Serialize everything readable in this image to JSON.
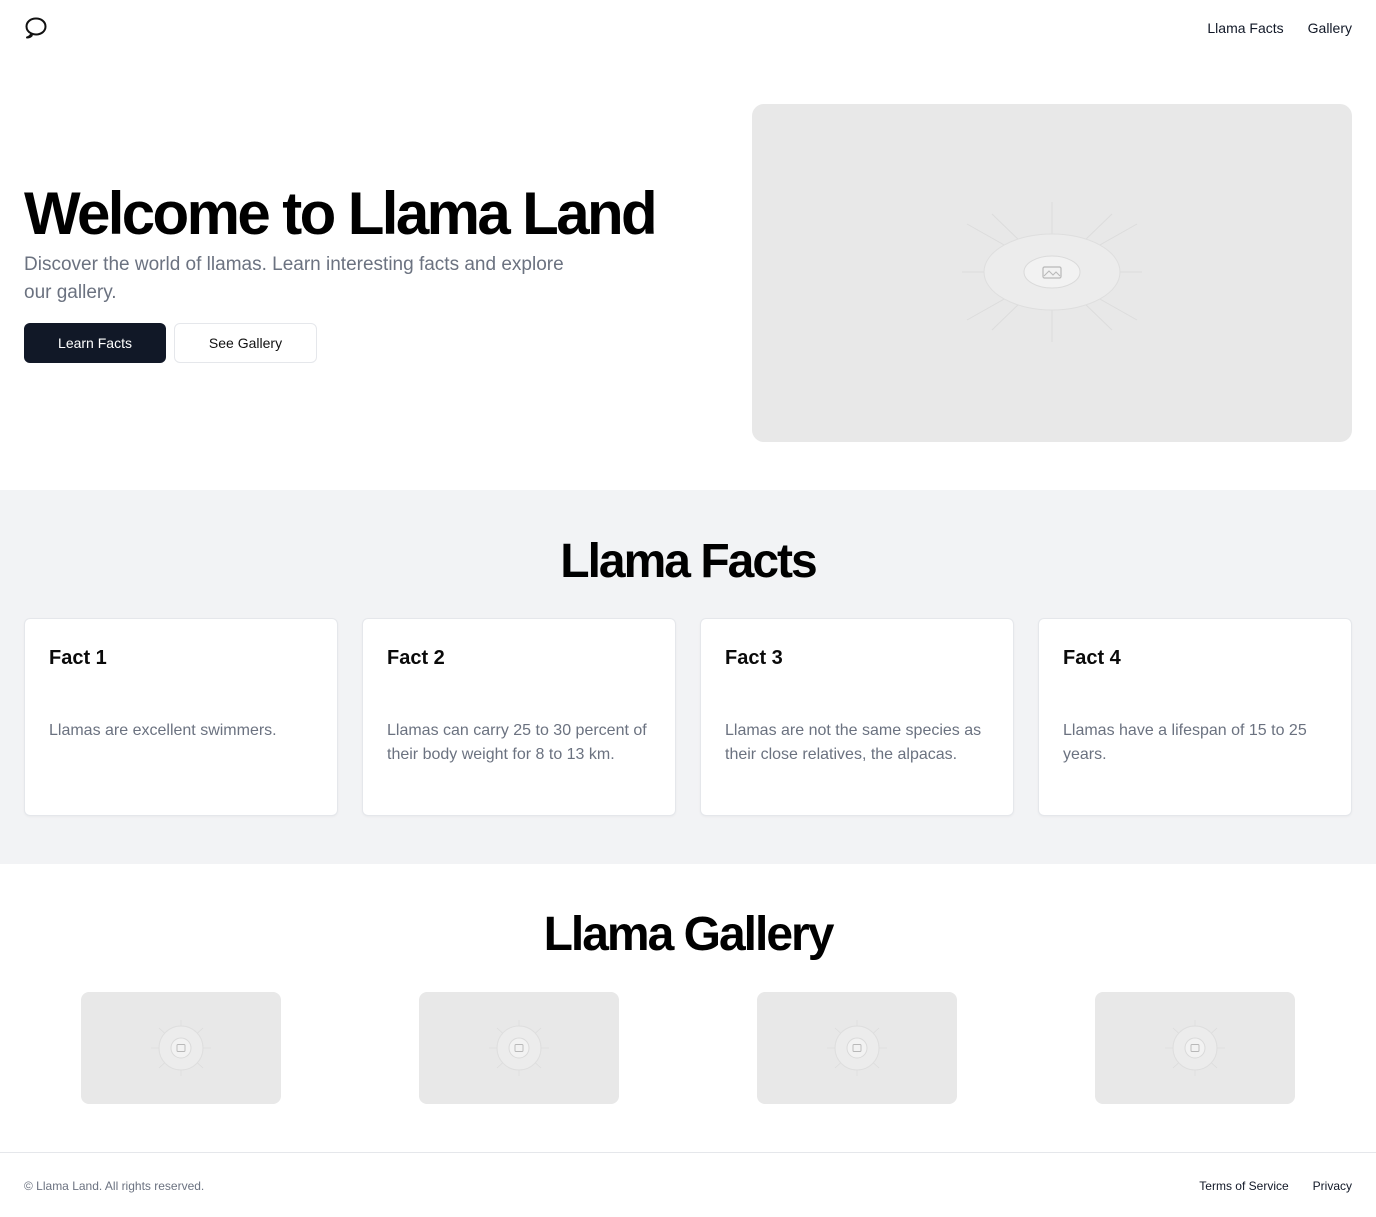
{
  "header": {
    "logo_icon": "speech-bubble-logo-icon",
    "nav": [
      "Llama Facts",
      "Gallery"
    ]
  },
  "hero": {
    "title": "Welcome to Llama Land",
    "subtitle": "Discover the world of llamas. Learn interesting facts and explore our gallery.",
    "primary_button": "Learn Facts",
    "secondary_button": "See Gallery",
    "image_icon": "image-placeholder-icon"
  },
  "facts": {
    "title": "Llama Facts",
    "items": [
      {
        "title": "Fact 1",
        "text": "Llamas are excellent swimmers."
      },
      {
        "title": "Fact 2",
        "text": "Llamas can carry 25 to 30 percent of their body weight for 8 to 13 km."
      },
      {
        "title": "Fact 3",
        "text": "Llamas are not the same species as their close relatives, the alpacas."
      },
      {
        "title": "Fact 4",
        "text": "Llamas have a lifespan of 15 to 25 years."
      }
    ]
  },
  "gallery": {
    "title": "Llama Gallery",
    "thumbnail_icon": "image-placeholder-icon",
    "thumbnail_count": 4
  },
  "footer": {
    "copyright": "© Llama Land. All rights reserved.",
    "links": [
      "Terms of Service",
      "Privacy"
    ]
  },
  "colors": {
    "primary_button_bg": "#111827",
    "muted_text": "#6b7280",
    "section_bg": "#f2f3f5",
    "placeholder_bg": "#e8e8e8"
  }
}
